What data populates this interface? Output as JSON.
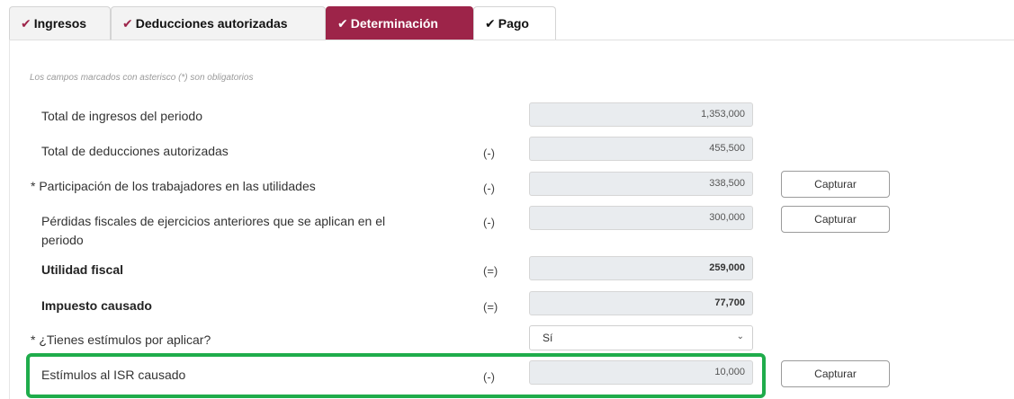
{
  "tabs": [
    {
      "label": "Ingresos",
      "icon": "check-icon",
      "state": "done"
    },
    {
      "label": "Deducciones autorizadas",
      "icon": "check-icon",
      "state": "done"
    },
    {
      "label": "Determinación",
      "icon": "check-icon",
      "state": "active"
    },
    {
      "label": "Pago",
      "icon": "check-icon",
      "state": "pending"
    }
  ],
  "check_glyph": "✔",
  "note": "Los campos marcados con asterisco (*) son obligatorios",
  "rows": [
    {
      "label": "Total de ingresos del periodo",
      "sign": "",
      "value": "1,353,000"
    },
    {
      "label": "Total de deducciones autorizadas",
      "sign": "(-)",
      "value": "455,500"
    },
    {
      "label": "* Participación de los trabajadores en las utilidades",
      "sign": "(-)",
      "value": "338,500",
      "button": "Capturar"
    },
    {
      "label": "Pérdidas fiscales de ejercicios anteriores que se aplican en el",
      "label2": "periodo",
      "sign": "(-)",
      "value": "300,000",
      "button": "Capturar"
    },
    {
      "label": "Utilidad fiscal",
      "sign": "(=)",
      "value": "259,000"
    },
    {
      "label": "Impuesto causado",
      "sign": "(=)",
      "value": "77,700"
    },
    {
      "label": "* ¿Tienes estímulos por aplicar?",
      "select_value": "Sí"
    },
    {
      "label": "Estímulos al ISR causado",
      "sign": "(-)",
      "value": "10,000",
      "button": "Capturar"
    }
  ],
  "colors": {
    "accent": "#9d2449",
    "highlight": "#1fac4b"
  }
}
